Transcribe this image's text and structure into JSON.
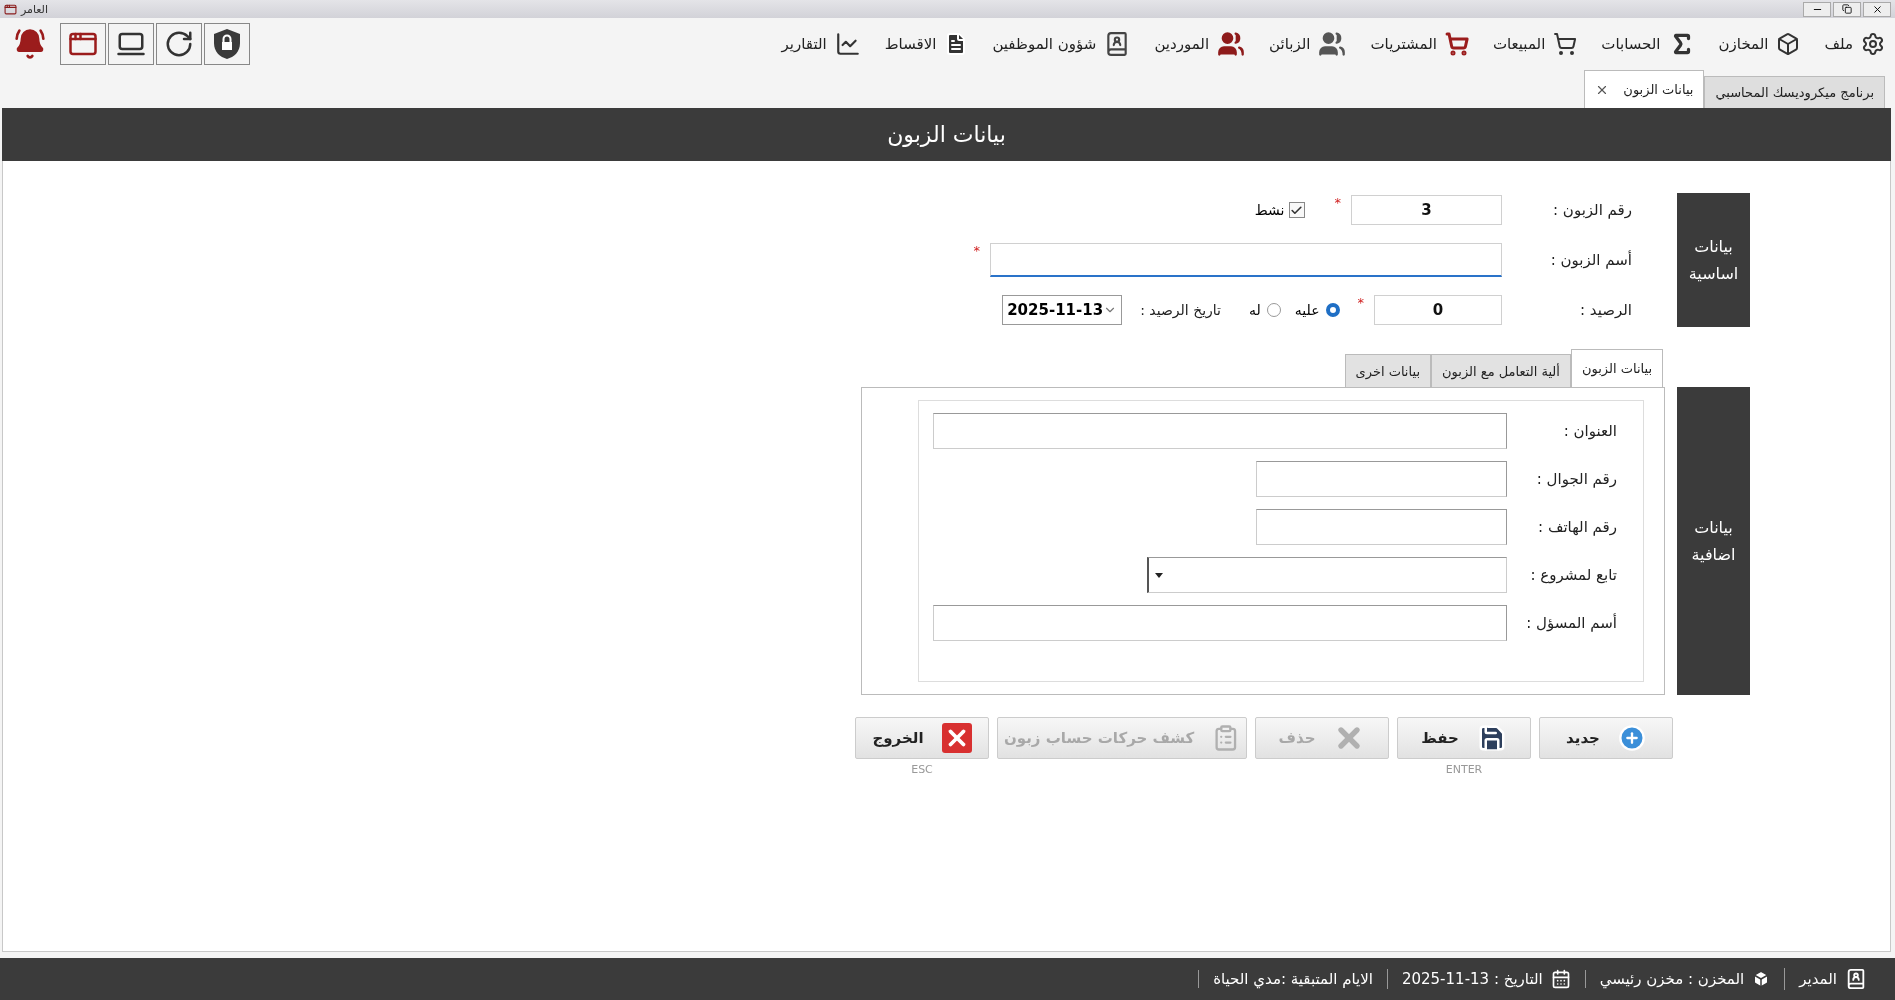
{
  "window": {
    "title": "العامر"
  },
  "menu": [
    {
      "label": "ملف"
    },
    {
      "label": "المخازن"
    },
    {
      "label": "الحسابات"
    },
    {
      "label": "المبيعات"
    },
    {
      "label": "المشتريات"
    },
    {
      "label": "الزبائن"
    },
    {
      "label": "الموردين"
    },
    {
      "label": "شؤون الموظفين"
    },
    {
      "label": "الاقساط"
    },
    {
      "label": "التقارير"
    }
  ],
  "doc_tabs": [
    {
      "label": "برنامج ميكروديسك المحاسبي",
      "selected": false,
      "closable": false
    },
    {
      "label": "بيانات الزبون",
      "selected": true,
      "closable": true
    }
  ],
  "page_title": "بيانات الزبون",
  "basic_section": {
    "side_label": "بيانات اساسية",
    "customer_number": {
      "label": "رقم الزبون :",
      "value": "3",
      "required_mark": "*"
    },
    "active": {
      "label": "نشط",
      "checked": true
    },
    "customer_name": {
      "label": "أسم الزبون :",
      "required_mark": "*",
      "focused": true
    },
    "balance": {
      "label": "الرصيد :",
      "value": "0",
      "required_mark": "*"
    },
    "balance_side": [
      {
        "label": "عليه",
        "selected": true
      },
      {
        "label": "له",
        "selected": false
      }
    ],
    "balance_date": {
      "label": "تاريخ الرصيد :",
      "value": "2025-11-13"
    }
  },
  "extra_section": {
    "side_label": "بيانات اضافية",
    "tabs": [
      {
        "label": "بيانات الزبون",
        "selected": true
      },
      {
        "label": "ألية التعامل مع الزبون",
        "selected": false
      },
      {
        "label": "بيانات اخرى",
        "selected": false
      }
    ],
    "fields": [
      {
        "label": "العنوان :",
        "kind": "wide"
      },
      {
        "label": "رقم الجوال :",
        "kind": "short"
      },
      {
        "label": "رقم الهاتف :",
        "kind": "short"
      },
      {
        "label": "تابع لمشروع :",
        "kind": "dropdown"
      },
      {
        "label": "أسم المسؤل :",
        "kind": "wide"
      }
    ]
  },
  "buttons": [
    {
      "label": "جديد",
      "kind": "new",
      "disabled": false
    },
    {
      "label": "حفظ",
      "kind": "save",
      "disabled": false,
      "shortcut": "ENTER"
    },
    {
      "label": "حذف",
      "kind": "delete",
      "disabled": true
    },
    {
      "label": "كشف حركات حساب زبون",
      "kind": "statement",
      "disabled": true
    },
    {
      "label": "الخروج",
      "kind": "exit",
      "disabled": false,
      "shortcut": "ESC"
    }
  ],
  "status_bar": [
    {
      "kind": "user",
      "text": "المدير"
    },
    {
      "kind": "store",
      "text": "المخزن : مخزن رئيسي"
    },
    {
      "kind": "date",
      "text": "التاريخ : 13-11-2025"
    },
    {
      "kind": "plain",
      "text": "الايام المتبقية :مدي الحياة"
    }
  ]
}
